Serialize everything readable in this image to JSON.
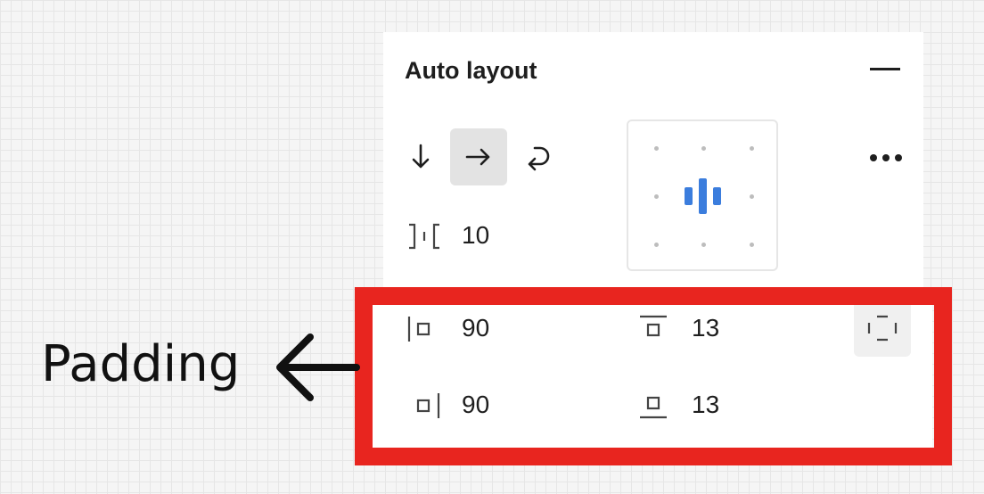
{
  "panel": {
    "title": "Auto layout",
    "direction": [
      {
        "name": "vertical",
        "icon": "arrow-down-icon",
        "active": false
      },
      {
        "name": "horizontal",
        "icon": "arrow-right-icon",
        "active": true
      },
      {
        "name": "wrap",
        "icon": "wrap-icon",
        "active": false
      }
    ],
    "gap": {
      "icon": "gap-between-icon",
      "value": "10"
    },
    "alignment": {
      "selected": "center"
    },
    "padding": {
      "left": {
        "icon": "padding-left-icon",
        "value": "90"
      },
      "top": {
        "icon": "padding-top-icon",
        "value": "13"
      },
      "right": {
        "icon": "padding-right-icon",
        "value": "90"
      },
      "bottom": {
        "icon": "padding-bottom-icon",
        "value": "13"
      }
    }
  },
  "annotation": {
    "label": "Padding",
    "highlight_color": "#e8251f"
  },
  "colors": {
    "accent": "#3b7ddd",
    "text": "#1e1e1e"
  }
}
